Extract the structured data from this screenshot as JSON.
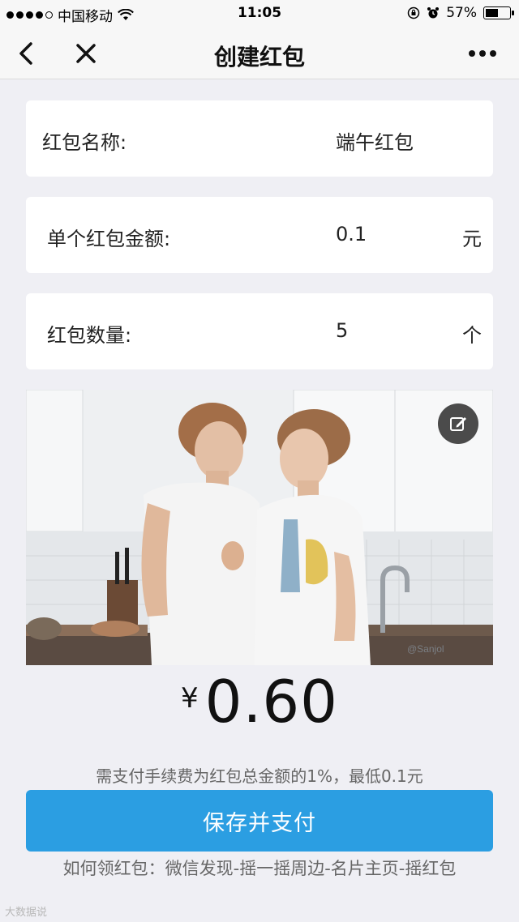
{
  "status_bar": {
    "carrier": "中国移动",
    "time": "11:05",
    "battery_percent": "57%",
    "battery_level": 0.57
  },
  "nav": {
    "title": "创建红包",
    "icons": [
      "chevron-left-icon",
      "close-icon",
      "more-icon"
    ]
  },
  "form": {
    "name_label": "红包名称:",
    "name_value": "端午红包",
    "amount_label": "单个红包金额:",
    "amount_value": "0.1",
    "amount_unit": "元",
    "count_label": "红包数量:",
    "count_value": "5",
    "count_unit": "个"
  },
  "cover": {
    "edit_icon": "edit-icon",
    "photo_watermark": "@Sanjol"
  },
  "total": {
    "currency": "¥",
    "amount": "0.60"
  },
  "fee_note": "需支付手续费为红包总金额的1%，最低0.1元",
  "pay_button": "保存并支付",
  "howto": "如何领红包：微信发现-摇一摇周边-名片主页-摇红包",
  "watermark": "大数据说",
  "colors": {
    "accent": "#2b9ee2",
    "background": "#efeff4"
  }
}
